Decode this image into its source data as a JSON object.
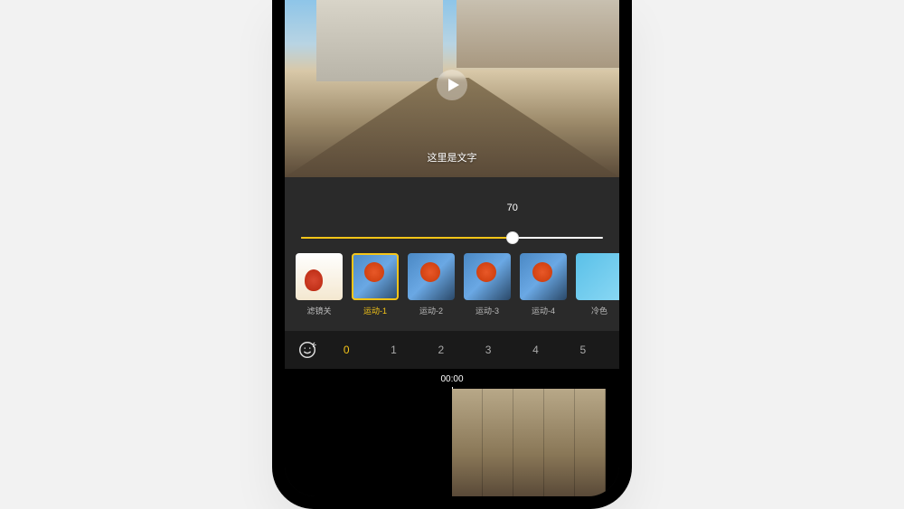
{
  "preview": {
    "caption": "这里是文字"
  },
  "slider": {
    "value": "70",
    "percent": 70
  },
  "filters": [
    {
      "label": "滤镜关",
      "style": "balloon",
      "selected": false
    },
    {
      "label": "运动-1",
      "style": "basket",
      "selected": true
    },
    {
      "label": "运动-2",
      "style": "basket",
      "selected": false
    },
    {
      "label": "运动-3",
      "style": "basket",
      "selected": false
    },
    {
      "label": "运动-4",
      "style": "basket",
      "selected": false
    },
    {
      "label": "冷色",
      "style": "cold",
      "selected": false
    }
  ],
  "tabs": {
    "items": [
      "0",
      "1",
      "2",
      "3",
      "4",
      "5"
    ],
    "active_index": 0
  },
  "timeline": {
    "time": "00:00"
  }
}
